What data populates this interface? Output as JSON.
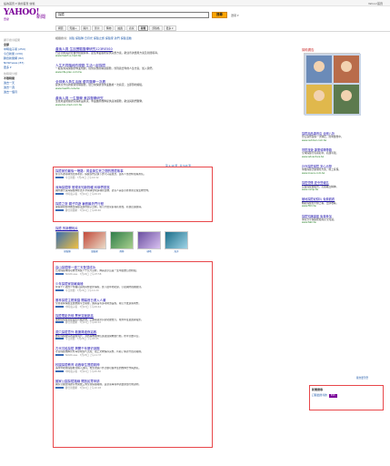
{
  "topbar": {
    "links": "設為首頁 ▾ 我的首頁  信箱",
    "right": "Yahoo!首頁"
  },
  "logo": {
    "yahoo": "YAHOO!",
    "sub": "奇摩",
    "news": "新聞"
  },
  "search": {
    "query": "探險",
    "button": "搜尋",
    "options": "選項 ▾"
  },
  "tabs": [
    {
      "label": "網頁"
    },
    {
      "label": "知識+"
    },
    {
      "label": "圖片"
    },
    {
      "label": "影片"
    },
    {
      "label": "購物"
    },
    {
      "label": "拍賣"
    },
    {
      "label": "商家"
    },
    {
      "label": "新聞",
      "active": true
    },
    {
      "label": "部落格"
    },
    {
      "label": "更多 ▾"
    }
  ],
  "sidebar": {
    "h1": "顯示搜尋結果",
    "items": [
      "全部",
      "中時電子報 (250)",
      "今日新聞 (130)",
      "聯合新聞網 (82)",
      "NOWnews (87)",
      "更多 ▾"
    ],
    "h2": "依時間分類",
    "items2": [
      "不限時間",
      "過去一天",
      "過去一週",
      "過去一個月"
    ]
  },
  "suggest": {
    "prefix": "相關搜尋：",
    "links": "冒險  探險隊  日月光  探險之旅 探險家  熱門  探險活動"
  },
  "results": [
    {
      "title": "產後人員 生技實驗醫學研究123RE5S0",
      "desc": "門診手術與研發醫學相關資料，最佳專業服務提供完整方案，歡迎查詢費用方案及新聞報導。",
      "url": "www.heart-e-med.tw"
    },
    {
      "title": "人生不同階段的規劃 生活一起探險",
      "desc": "一般投資與保險的專業規劃，提供完整的解說服務，找到適合你的人生方案，加入我們。",
      "url": "www.life-plan.com.tw"
    },
    {
      "title": "全球美人魚生活館 優質醫學一次看",
      "desc": "提供全方位的健康管理服務，從日常保健到專業醫療一次搞定，立即預約體驗。",
      "url": "www.health-care.tw"
    },
    {
      "title": "產後人員 一生醫學 美容醫學研究",
      "desc": "生技產業相關研究與產品資訊，專業醫師團隊提供諮詢服務，歡迎與我們聯繫。",
      "url": "www.bio-med.com.tw"
    }
  ],
  "more_link": "第 1-10 筆 · 共 543 筆",
  "news1": [
    {
      "title": "探險家的最後一哩路：黃金與生死之間的冒險故事",
      "desc": "從亞馬遜雨林到北極冰原，探險家們記錄下的不只是風景，還有人性的極限與勇氣。",
      "meta": "今日新聞 · 7月24日 上午10:32"
    },
    {
      "title": "深海探險隊 發現未知新物種 科學界振奮",
      "desc": "國際聯合深海探險隊在太平洋海溝發現多種新生物，研究人員表示將重新定義生物分佈。",
      "meta": "中時電子報 · 7月24日 上午09:15"
    },
    {
      "title": "探險之旅 親子同遊 暑假最熱門行程",
      "desc": "暑假期間各地推出探險主題的親子活動，吸引大批家庭報名參加，名額迅速額滿。",
      "meta": "聯合新聞網 · 7月24日 上午08:40"
    }
  ],
  "images": {
    "head": "探險 的新聞相片",
    "caps": [
      "探險隊",
      "冒險家",
      "雨林",
      "極地",
      "海洋"
    ]
  },
  "news2": [
    {
      "title": "高山探險隊一連三天登頂成功",
      "desc": "台灣探險隊成功攀登海拔八千公尺高峰，隊員表示這是一生中最難忘的經驗。",
      "meta": "NOWnews · 7月24日 上午07:58"
    },
    {
      "title": "少年探險家挑戰南極",
      "desc": "年僅十八歲的少年獨自完成南極徒步探險，創下最年輕紀錄，引起國際媒體關注。",
      "meta": "今日新聞 · 7月23日 下午11:20"
    },
    {
      "title": "叢林探險主題樂園 開幕首日湧入人潮",
      "desc": "全新叢林探險主題樂園今日開幕，園區設有多項刺激設施，吸引大批遊客朝聖。",
      "meta": "中時電子報 · 7月23日 下午09:44"
    },
    {
      "title": "探險電影熱映 票房突破新高",
      "desc": "暑期檔探險冒險電影持續熱映，上映兩週票房即突破億元，成為年度最賣座電影。",
      "meta": "聯合新聞網 · 7月23日 下午06:12"
    },
    {
      "title": "洞穴探險意外 救援隊連夜搶救",
      "desc": "數名探險愛好者受困洞穴，消防與救援隊伍連夜展開救援行動，所幸全數平安。",
      "meta": "今日新聞 · 7月23日 下午03:05"
    },
    {
      "title": "古代沉船探險 揭開千年歷史謎團",
      "desc": "考古探險團隊於外海發現古代沉船，船上文物保存完整，有助了解古代貿易路線。",
      "meta": "NOWnews · 7月23日 上午11:37"
    },
    {
      "title": "校園探險教育 培養學生冒險精神",
      "desc": "多所學校將探險教育納入課程，希望透過戶外活動培養學生的團隊合作與勇氣。",
      "meta": "中時電子報 · 7月22日 下午05:50"
    },
    {
      "title": "國家公園探險路線 開放民眾申請",
      "desc": "國家公園管理處宣布開放三條全新探險路線，民眾需事先申請並參加行前說明。",
      "meta": "聯合新聞網 · 7月22日 上午10:18"
    }
  ],
  "ads": {
    "head": "贊助廣告",
    "items": [
      {
        "title": "探險用品專賣店 全館八折",
        "desc": "登山露營裝備一次購足，限時優惠中。",
        "url": "www.outdoor.com.tw"
      },
      {
        "title": "冒險旅遊 專業領隊帶路",
        "desc": "全球探險行程報名中，名額有限。",
        "url": "www.adventure.tw"
      },
      {
        "title": "戶外探險保險 安心出發",
        "desc": "專屬探險活動保障方案，線上投保。",
        "url": "www.insure.com.tw"
      },
      {
        "title": "探險營隊 夏令營報名",
        "desc": "兒童探險體驗營，培養獨立精神。",
        "url": "www.camp.tw"
      },
      {
        "title": "極地探險紀錄片 免費觀看",
        "desc": "精彩探險影片線上看，立即收看。",
        "url": "www.film.tw"
      },
      {
        "title": "探險知識講座 免費參加",
        "desc": "專家分享探險經驗與安全知識。",
        "url": "www.talk.tw"
      }
    ],
    "more": "我也要刊登"
  },
  "rightbox": {
    "head": "新聞搜尋",
    "item": "訂閱此搜尋的",
    "badge": "RSS"
  },
  "colors": {
    "brand": "#7b0099",
    "link": "#1a0dab",
    "highlight": "#e8474a",
    "button": "#ffa500"
  }
}
